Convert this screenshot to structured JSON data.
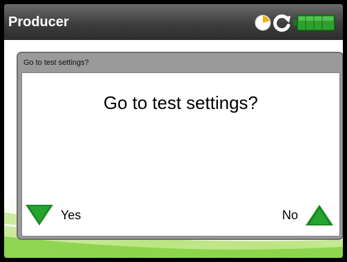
{
  "app": {
    "title": "Producer"
  },
  "status": {
    "icons": [
      "clock-icon",
      "refresh-icon",
      "battery-icon"
    ],
    "battery_color": "#2ea02e"
  },
  "dialog": {
    "header": "Go to test settings?",
    "message": "Go to test settings?",
    "yes_label": "Yes",
    "no_label": "No"
  },
  "colors": {
    "titlebar": "#3e3e3e",
    "dialog_frame": "#9a9a9a",
    "accent_green": "#1f9a2a"
  }
}
